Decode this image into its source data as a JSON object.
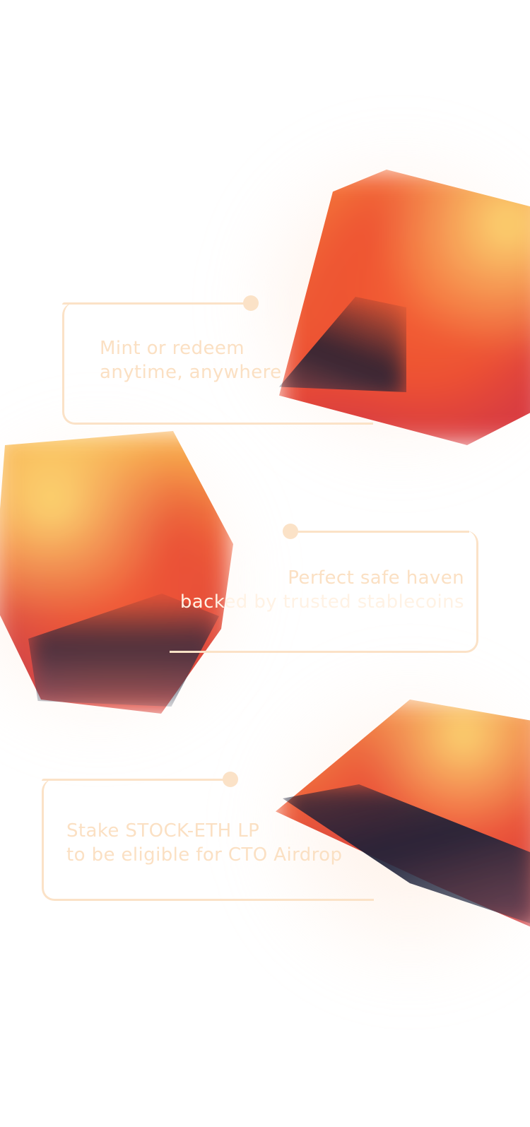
{
  "colors": {
    "card_border": "#fbe2c7",
    "card_text": "#fbe0c3",
    "cube_yellow": "#fcd66b",
    "cube_orange": "#f45c2d",
    "cube_shadow": "#232032"
  },
  "features": [
    {
      "line1": "Mint or redeem",
      "line2": "anytime, anywhere"
    },
    {
      "line1": "Perfect safe haven",
      "line2": "backed by trusted stablecoins"
    },
    {
      "line1": "Stake STOCK-ETH LP",
      "line2": "to be eligible for CTO Airdrop"
    }
  ]
}
